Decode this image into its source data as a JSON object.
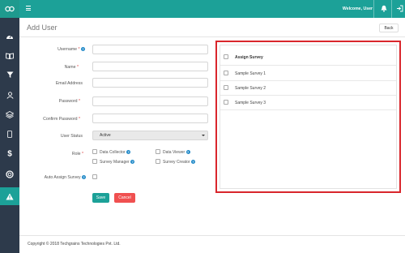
{
  "topbar": {
    "welcome": "Welcome, User"
  },
  "page": {
    "title": "Add User",
    "back_label": "Back"
  },
  "form": {
    "username_label": "Username",
    "name_label": "Name",
    "email_label": "Email Address",
    "password_label": "Password",
    "confirm_password_label": "Confirm Password",
    "user_status_label": "User Status",
    "user_status_value": "Active",
    "role_label": "Role",
    "roles": [
      "Data Collector",
      "Data Viewer",
      "Survey Manager",
      "Survey Creator"
    ],
    "auto_assign_label": "Auto Assign Survey",
    "required_mark": "*",
    "help_glyph": "?",
    "save_label": "Save",
    "cancel_label": "Cancel"
  },
  "assign": {
    "header": "Assign Survey",
    "surveys": [
      "Sample Survey 1",
      "Sample Survey 2",
      "Sample Survey 3"
    ]
  },
  "footer": {
    "copyright": "Copyright © 2018 Techgrains Technologies Pvt. Ltd."
  },
  "colors": {
    "accent": "#1ca198",
    "sidebar": "#2d3a4b",
    "danger": "#f05050",
    "highlight": "#d9262c",
    "help": "#1e88c7"
  },
  "icons": [
    "infinity-logo-icon",
    "menu-icon",
    "dashboard-icon",
    "book-icon",
    "filter-icon",
    "user-icon",
    "layers-icon",
    "mobile-icon",
    "dollar-icon",
    "support-icon",
    "warning-icon",
    "bell-icon",
    "sign-out-icon"
  ]
}
